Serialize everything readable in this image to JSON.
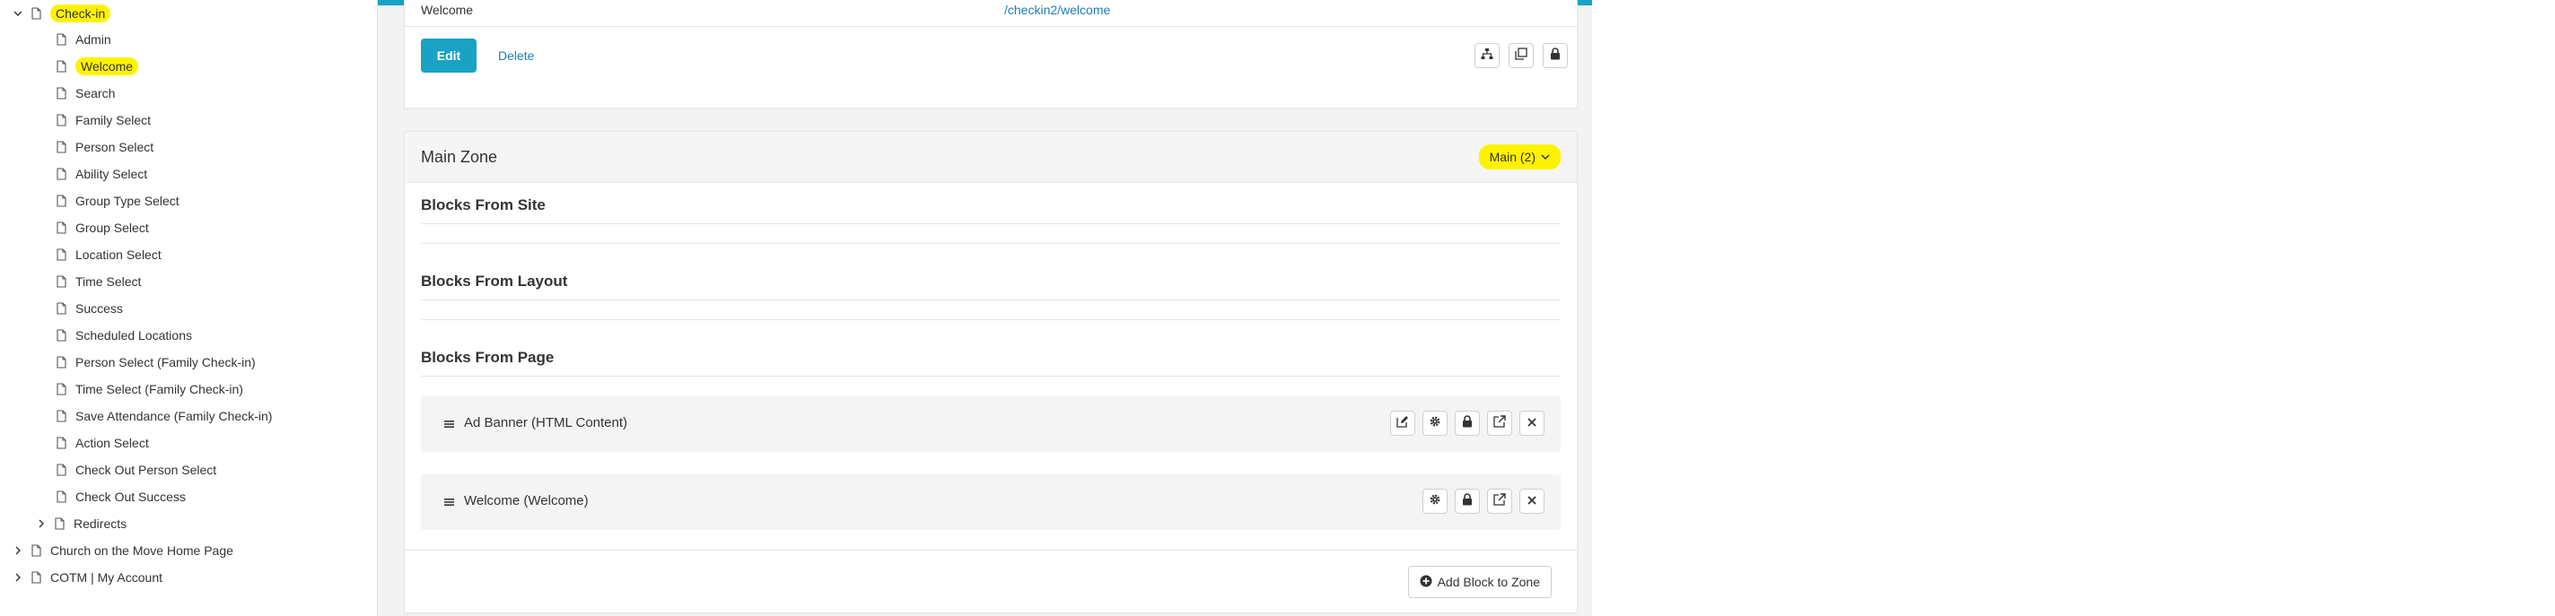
{
  "sidebar": {
    "root": {
      "label": "Check-in"
    },
    "children": [
      {
        "label": "Admin"
      },
      {
        "label": "Welcome"
      },
      {
        "label": "Search"
      },
      {
        "label": "Family Select"
      },
      {
        "label": "Person Select"
      },
      {
        "label": "Ability Select"
      },
      {
        "label": "Group Type Select"
      },
      {
        "label": "Group Select"
      },
      {
        "label": "Location Select"
      },
      {
        "label": "Time Select"
      },
      {
        "label": "Success"
      },
      {
        "label": "Scheduled Locations"
      },
      {
        "label": "Person Select (Family Check-in)"
      },
      {
        "label": "Time Select (Family Check-in)"
      },
      {
        "label": "Save Attendance (Family Check-in)"
      },
      {
        "label": "Action Select"
      },
      {
        "label": "Check Out Person Select"
      },
      {
        "label": "Check Out Success"
      },
      {
        "label": "Redirects"
      }
    ],
    "siblings": [
      {
        "label": "Church on the Move Home Page"
      },
      {
        "label": "COTM | My Account"
      }
    ]
  },
  "page_info": {
    "name": "Welcome",
    "route": "/checkin2/welcome",
    "edit_label": "Edit",
    "delete_label": "Delete"
  },
  "zone": {
    "title": "Main Zone",
    "selector_label": "Main (2)",
    "sections": {
      "site": "Blocks From Site",
      "layout": "Blocks From Layout",
      "page": "Blocks From Page"
    },
    "blocks": [
      {
        "label": "Ad Banner (HTML Content)"
      },
      {
        "label": "Welcome (Welcome)"
      }
    ],
    "add_block_label": "Add Block to Zone"
  },
  "colors": {
    "accent": "#1aa2c4",
    "link": "#1a7fb3",
    "highlight": "#fff200"
  }
}
